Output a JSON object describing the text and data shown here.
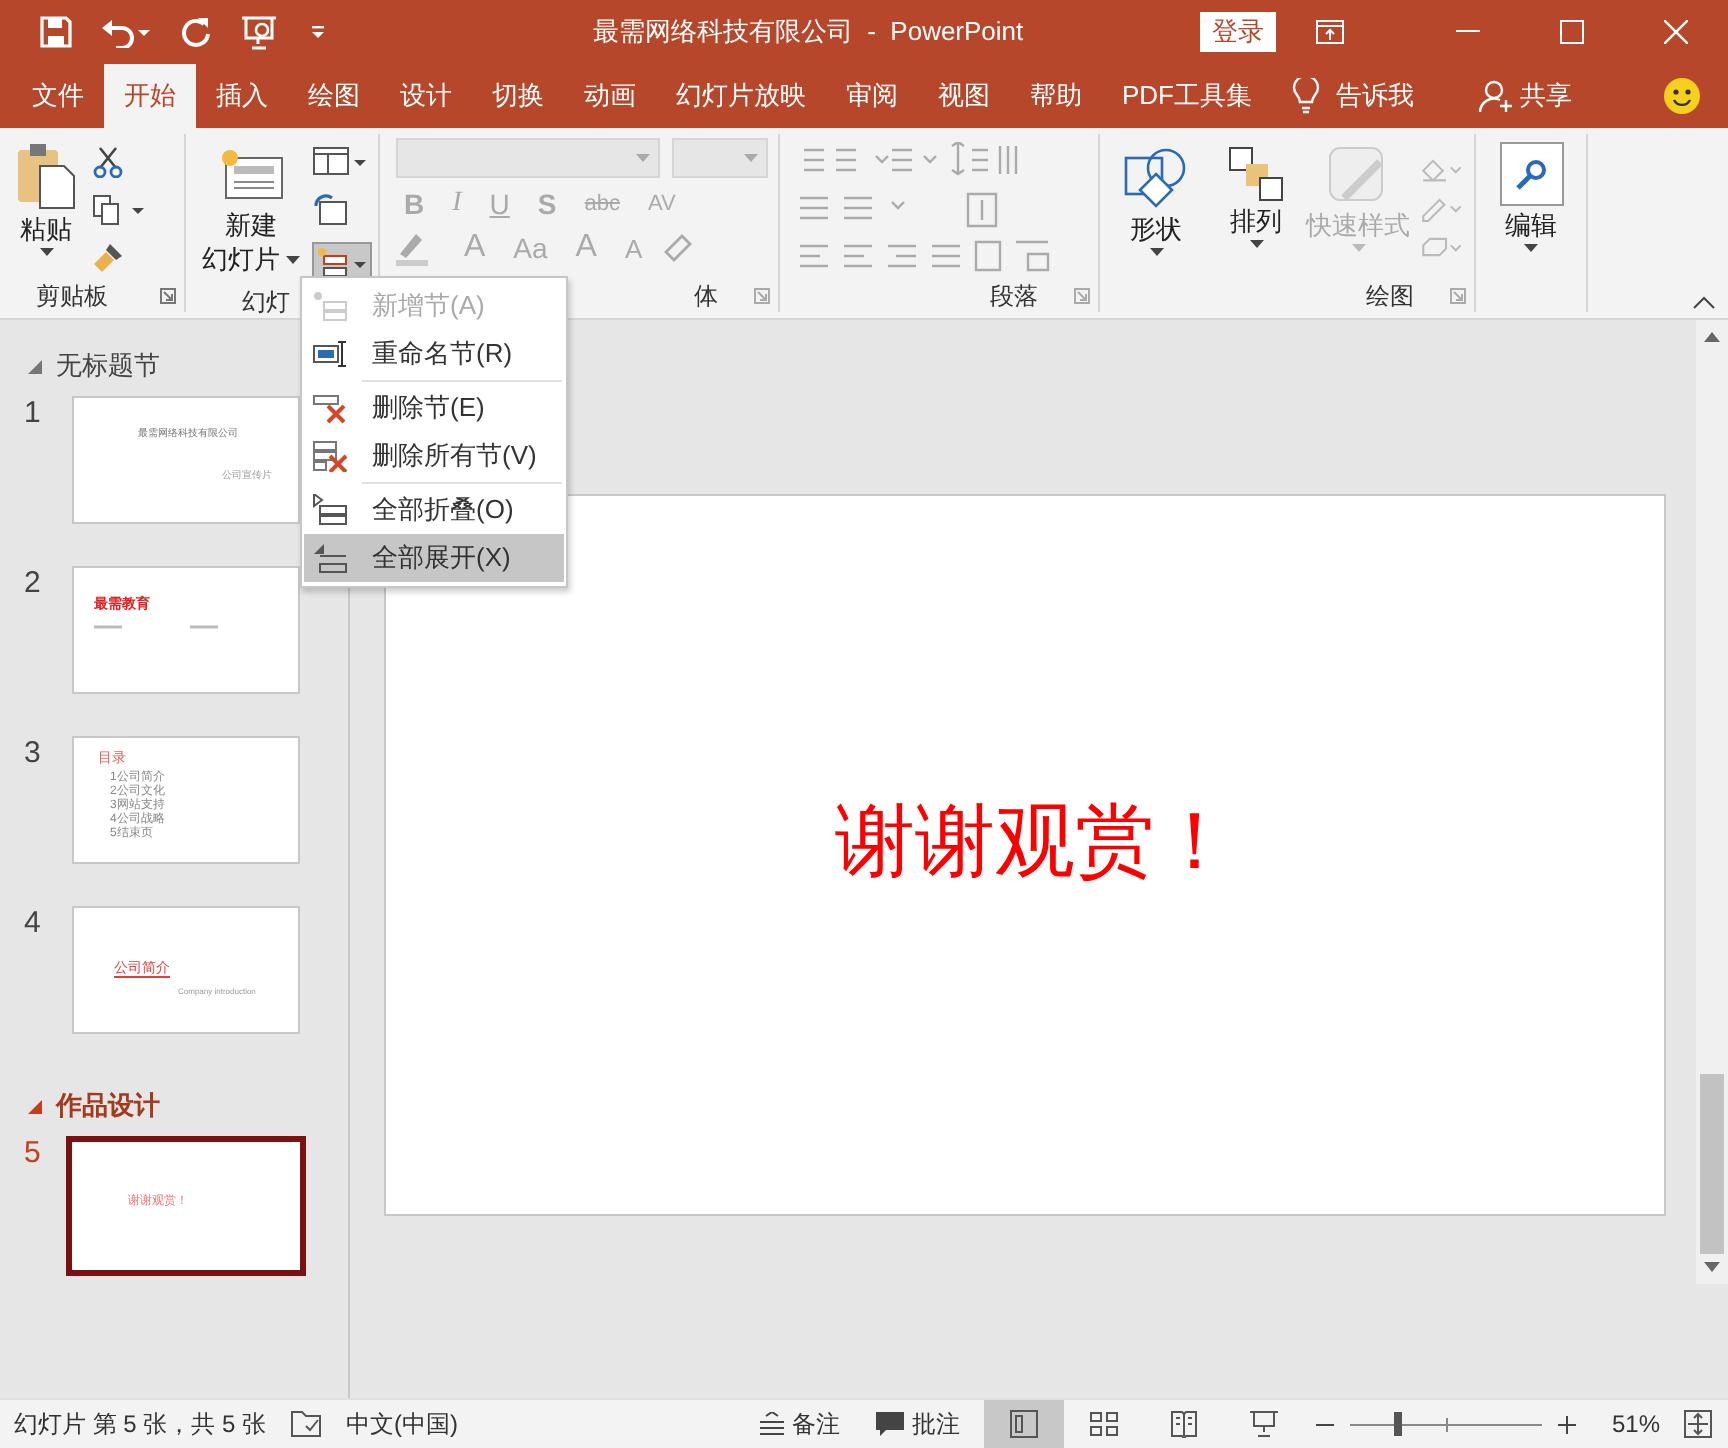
{
  "title_bar": {
    "title": "最需网络科技有限公司  -  PowerPoint",
    "login": "登录"
  },
  "tabs": [
    {
      "label": "文件",
      "selected": false
    },
    {
      "label": "开始",
      "selected": true
    },
    {
      "label": "插入",
      "selected": false
    },
    {
      "label": "绘图",
      "selected": false
    },
    {
      "label": "设计",
      "selected": false
    },
    {
      "label": "切换",
      "selected": false
    },
    {
      "label": "动画",
      "selected": false
    },
    {
      "label": "幻灯片放映",
      "selected": false
    },
    {
      "label": "审阅",
      "selected": false
    },
    {
      "label": "视图",
      "selected": false
    },
    {
      "label": "帮助",
      "selected": false
    },
    {
      "label": "PDF工具集",
      "selected": false
    }
  ],
  "tell_me": "告诉我",
  "share": "共享",
  "ribbon": {
    "clipboard": {
      "paste": "粘贴",
      "label": "剪贴板"
    },
    "slides": {
      "new_slide": [
        "新建",
        "幻灯片"
      ],
      "label": "幻灯"
    },
    "font": {
      "disabled": true,
      "format_row": [
        "B",
        "I",
        "U",
        "S",
        "abc",
        "AV"
      ],
      "size_row": [
        "A",
        "Aa",
        "A",
        "A"
      ],
      "label": "体"
    },
    "paragraph": {
      "label": "段落"
    },
    "drawing": {
      "buttons": [
        {
          "kind": "shapes",
          "label": "形状",
          "disabled": false
        },
        {
          "kind": "arrange",
          "label": "排列",
          "disabled": false
        },
        {
          "kind": "styles",
          "label": "快速样式",
          "disabled": true
        }
      ],
      "label": "绘图"
    },
    "editing": {
      "label": "编辑"
    }
  },
  "section_menu": [
    {
      "kind": "add",
      "label": "新增节(A)",
      "disabled": true,
      "selected": false
    },
    {
      "kind": "rename",
      "label": "重命名节(R)",
      "disabled": false,
      "selected": false
    },
    {
      "kind": "delete",
      "label": "删除节(E)",
      "disabled": false,
      "selected": false
    },
    {
      "kind": "delete_all",
      "label": "删除所有节(V)",
      "disabled": false,
      "selected": false
    },
    {
      "kind": "collapse",
      "label": "全部折叠(O)",
      "disabled": false,
      "selected": false
    },
    {
      "kind": "expand",
      "label": "全部展开(X)",
      "disabled": false,
      "selected": true
    }
  ],
  "sections": [
    {
      "title": "无标题节",
      "selected": false,
      "slides": [
        {
          "number": "1",
          "selected": false,
          "kind": "title",
          "texts": [
            "最需网络科技有限公司",
            "公司宣传片"
          ]
        },
        {
          "number": "2",
          "selected": false,
          "kind": "heading",
          "texts": [
            "最需教育"
          ]
        },
        {
          "number": "3",
          "selected": false,
          "kind": "toc",
          "texts": [
            "目录",
            "1公司简介",
            "2公司文化",
            "3网站支持",
            "4公司战略",
            "5结束页"
          ]
        },
        {
          "number": "4",
          "selected": false,
          "kind": "intro",
          "texts": [
            "公司简介",
            "Company introduction"
          ]
        }
      ]
    },
    {
      "title": "作品设计",
      "selected": true,
      "slides": [
        {
          "number": "5",
          "selected": true,
          "kind": "thanks",
          "texts": [
            "谢谢观赏！"
          ]
        }
      ]
    }
  ],
  "current_slide": {
    "text": "谢谢观赏！"
  },
  "status_bar": {
    "slide_info": "幻灯片 第 5 张，共 5 张",
    "language": "中文(中国)",
    "notes": "备注",
    "comments": "批注",
    "views": [
      {
        "kind": "normal",
        "selected": true
      },
      {
        "kind": "sorter",
        "selected": false
      },
      {
        "kind": "reading",
        "selected": false
      },
      {
        "kind": "show",
        "selected": false
      }
    ],
    "zoom": {
      "level": 0.25,
      "percent": "51%"
    }
  }
}
